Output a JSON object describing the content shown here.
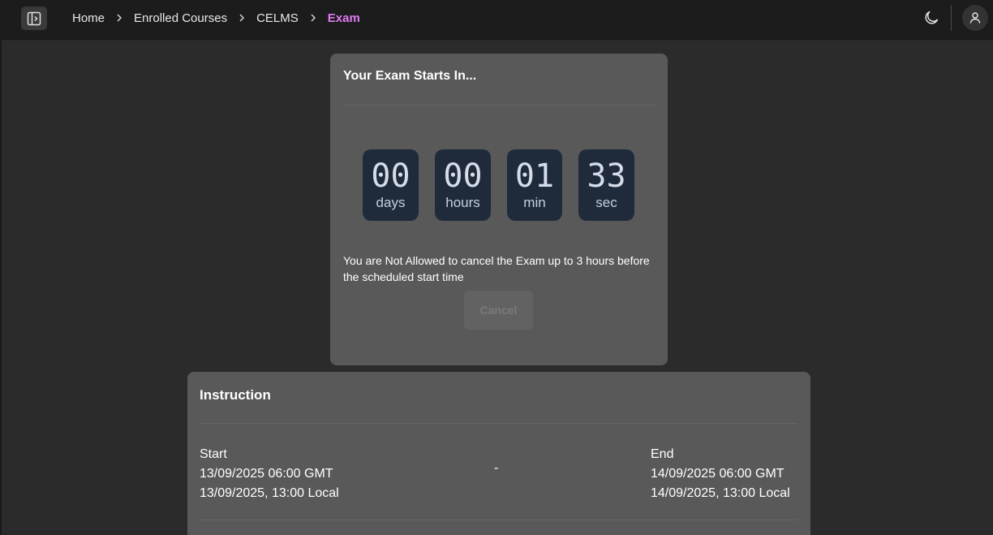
{
  "header": {
    "breadcrumb": [
      "Home",
      "Enrolled Courses",
      "CELMS",
      "Exam"
    ],
    "colors": {
      "active_crumb": "#e07bf0",
      "topbar": "#1c1c1c"
    },
    "icons": {
      "sidebar_toggle": "sidebar-toggle-icon",
      "theme": "moon-icon",
      "profile": "user-icon"
    }
  },
  "exam": {
    "title": "Your Exam Starts In...",
    "countdown": [
      {
        "value": "00",
        "unit": "days"
      },
      {
        "value": "00",
        "unit": "hours"
      },
      {
        "value": "01",
        "unit": "min"
      },
      {
        "value": "33",
        "unit": "sec"
      }
    ],
    "notice": "You are Not Allowed to cancel the Exam up to 3 hours before the scheduled start time",
    "cancel_label": "Cancel"
  },
  "instruction": {
    "title": "Instruction",
    "start": {
      "label": "Start",
      "gmt": "13/09/2025 06:00 GMT",
      "local": "13/09/2025, 13:00 Local"
    },
    "separator": "-",
    "end": {
      "label": "End",
      "gmt": "14/09/2025 06:00 GMT",
      "local": "14/09/2025, 13:00 Local"
    }
  }
}
